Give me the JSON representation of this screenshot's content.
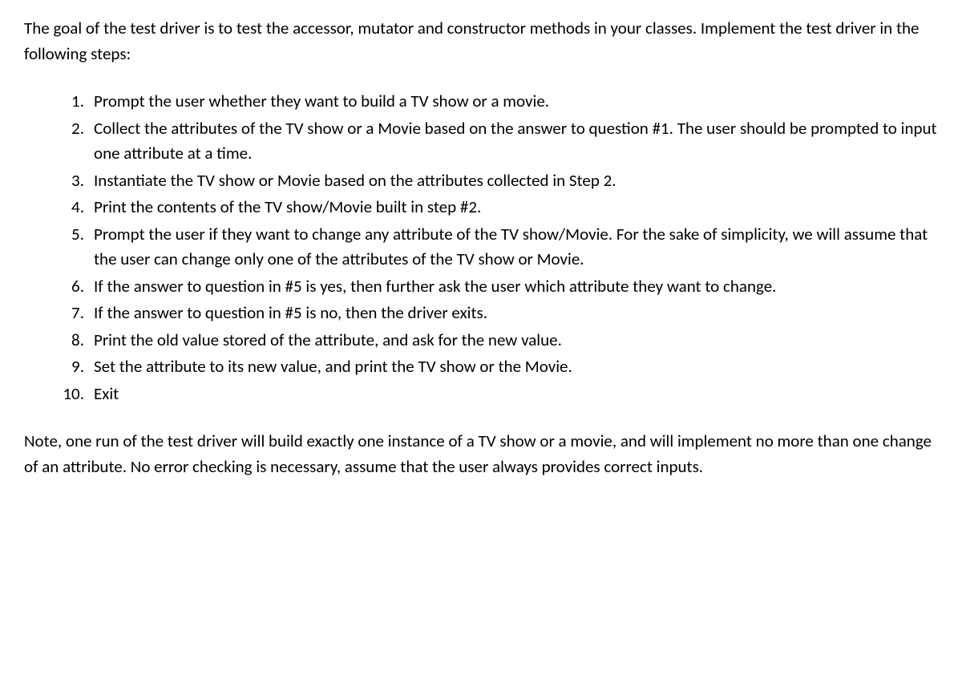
{
  "intro": "The goal of the test driver is to test the accessor, mutator and constructor methods in your classes. Implement the test driver in the following steps:",
  "steps": [
    {
      "num": "1.",
      "text": "Prompt the user whether they want to build a TV show or a movie."
    },
    {
      "num": "2.",
      "text": "Collect the attributes of the TV show or a Movie based on the answer to question #1. The user should be prompted to input one attribute at a time."
    },
    {
      "num": "3.",
      "text": "Instantiate the TV show or Movie based on the attributes collected in Step 2."
    },
    {
      "num": "4.",
      "text": "Print the contents of the TV show/Movie built in step #2."
    },
    {
      "num": "5.",
      "text": "Prompt the user if they want to change any attribute of the TV show/Movie. For the sake of simplicity, we will assume that the user can change only one of the attributes of the TV show or Movie."
    },
    {
      "num": "6.",
      "text": "If the answer to question in #5 is yes, then further ask the user which attribute they want to change."
    },
    {
      "num": "7.",
      "text": "If the answer to question in #5 is no, then the driver exits."
    },
    {
      "num": "8.",
      "text": "Print the old value stored of the attribute, and ask for the new value."
    },
    {
      "num": "9.",
      "text": "Set the attribute to its new value, and print the TV show or the Movie."
    },
    {
      "num": "10.",
      "text": "Exit"
    }
  ],
  "note": "Note, one run of the test driver will build exactly one instance of a TV show or a movie, and will implement no more than one change of an attribute. No error checking is necessary, assume that the user always provides correct inputs."
}
